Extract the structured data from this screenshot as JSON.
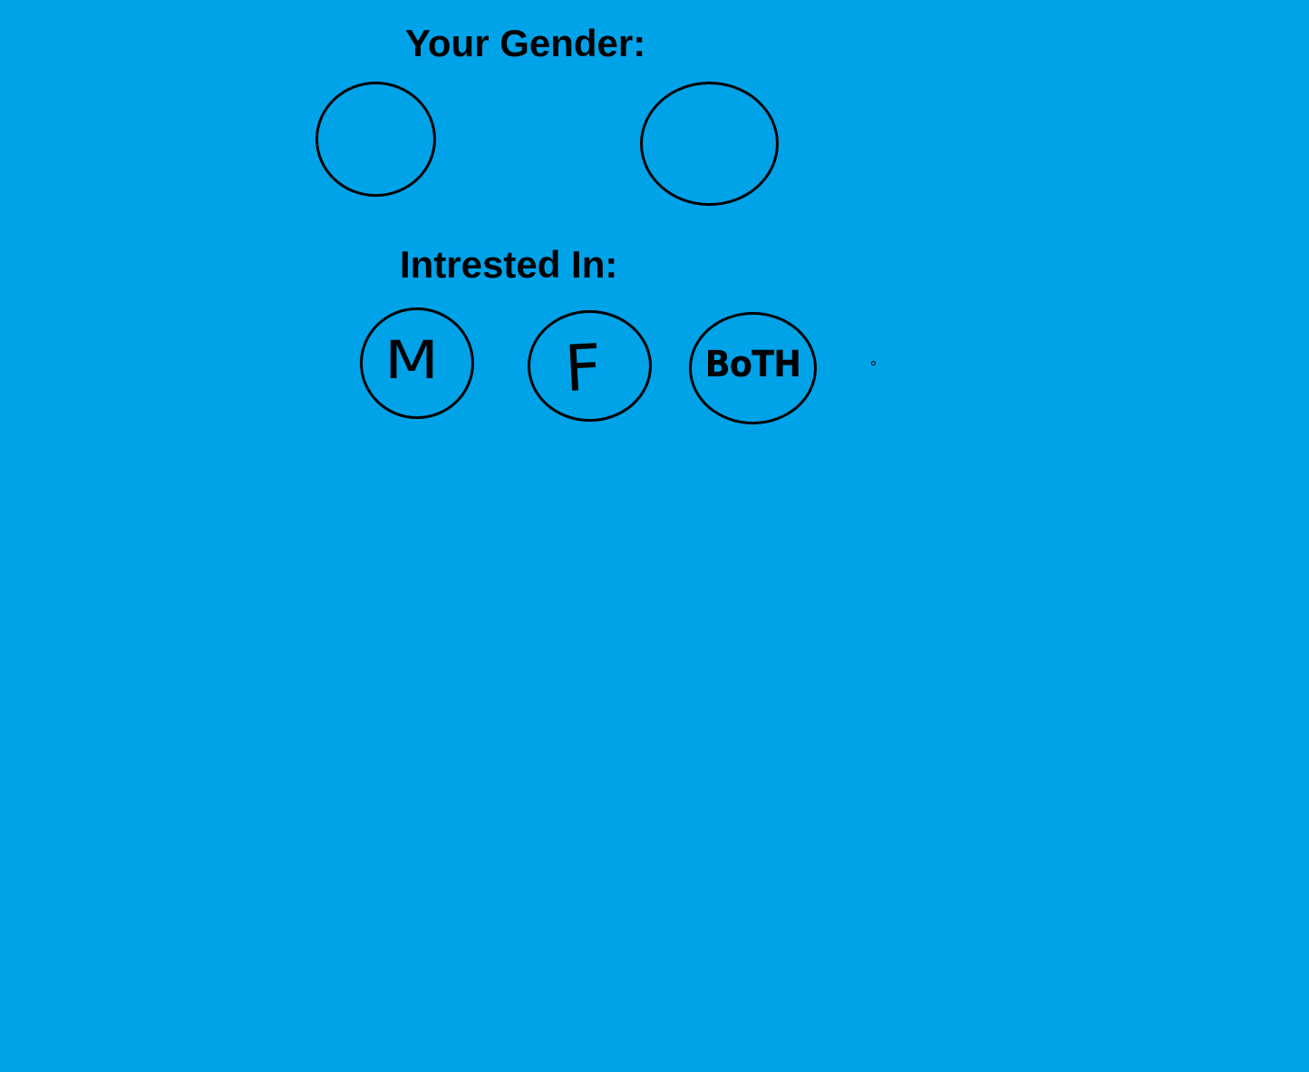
{
  "background_color": "#00a2e8",
  "gender_section": {
    "heading": "Your Gender:",
    "options": [
      {
        "label": ""
      },
      {
        "label": ""
      }
    ]
  },
  "interest_section": {
    "heading": "Intrested In:",
    "options": [
      {
        "label": "M"
      },
      {
        "label": "F"
      },
      {
        "label": "BoTH"
      }
    ]
  }
}
